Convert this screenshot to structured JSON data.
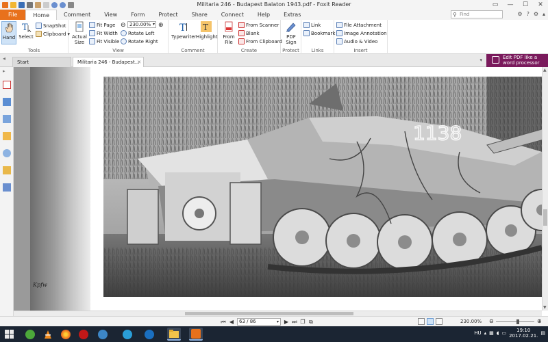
{
  "window": {
    "title": "Militaria 246 - Budapest Balaton 1943.pdf - Foxit Reader"
  },
  "ribbon_tabs": [
    "File",
    "Home",
    "Comment",
    "View",
    "Form",
    "Protect",
    "Share",
    "Connect",
    "Help",
    "Extras"
  ],
  "active_tab": "Home",
  "search": {
    "placeholder": "Find"
  },
  "ribbon": {
    "tools": {
      "label": "Tools",
      "hand": "Hand",
      "select": "Select",
      "snapshot": "SnapShot",
      "clipboard": "Clipboard"
    },
    "view": {
      "label": "View",
      "actual_size_line1": "Actual",
      "actual_size_line2": "Size",
      "fit_page": "Fit Page",
      "fit_width": "Fit Width",
      "fit_visible": "Fit Visible",
      "zoom_value": "230.00%",
      "rotate_left": "Rotate Left",
      "rotate_right": "Rotate Right"
    },
    "comment": {
      "label": "Comment",
      "typewriter": "Typewriter",
      "highlight": "Highlight"
    },
    "create": {
      "label": "Create",
      "from_file_line1": "From",
      "from_file_line2": "File",
      "from_scanner": "From Scanner",
      "blank": "Blank",
      "from_clipboard": "From Clipboard"
    },
    "protect": {
      "label": "Protect",
      "pdf_sign_line1": "PDF",
      "pdf_sign_line2": "Sign"
    },
    "links": {
      "label": "Links",
      "link": "Link",
      "bookmark": "Bookmark"
    },
    "insert": {
      "label": "Insert",
      "file_attachment": "File Attachment",
      "image_annotation": "Image Annotation",
      "audio_video": "Audio & Video"
    }
  },
  "doc_tabs": {
    "start": "Start",
    "current": "Militaria 246 - Budapest..."
  },
  "banner": {
    "line1": "Edit PDF like a",
    "line2": "word processor"
  },
  "page_content": {
    "side_caption": "Kpfw"
  },
  "statusbar": {
    "page_indicator": "63 / 86",
    "zoom": "230.00%"
  },
  "taskbar": {
    "lang": "HU",
    "time": "19:10",
    "date": "2017.02.21."
  },
  "colors": {
    "file_tab": "#e8711c",
    "banner": "#7a1a5c",
    "taskbar": "#1b2533",
    "doc_bg": "#9a9a9a"
  }
}
